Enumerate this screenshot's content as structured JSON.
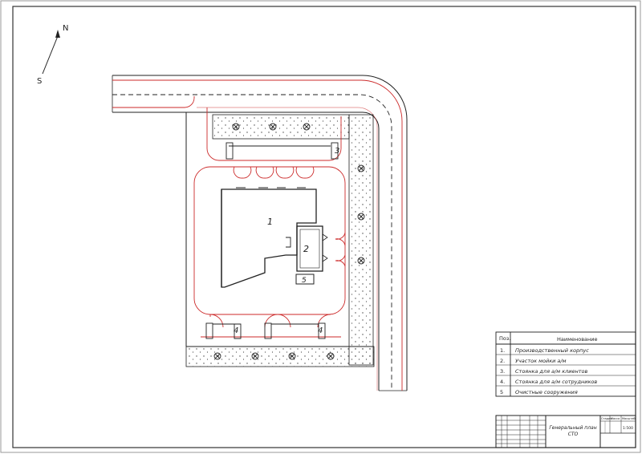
{
  "compass": {
    "north": "N",
    "south": "S"
  },
  "plan_labels": {
    "building": "1",
    "wash": "2",
    "client_parking": "3",
    "staff_parking_a": "4",
    "staff_parking_b": "4",
    "treatment": "5"
  },
  "legend": {
    "pos_header": "Поз.",
    "name_header": "Наименование",
    "rows": [
      {
        "pos": "1.",
        "name": "Производственный корпус"
      },
      {
        "pos": "2.",
        "name": "Участок мойки а/м"
      },
      {
        "pos": "3.",
        "name": "Стоянка для а/м клиентов"
      },
      {
        "pos": "4.",
        "name": "Стоянка для а/м сотрудников"
      },
      {
        "pos": "5",
        "name": "Очистные сооружения"
      }
    ]
  },
  "title_block": {
    "title_line1": "Генеральный план",
    "title_line2": "СТО",
    "stage_header": "Стадия",
    "sheet_header": "Масса",
    "scale_header": "Масштаб",
    "scale_value": "1:500"
  },
  "colors": {
    "line": "#222222",
    "road_edge": "#cc2a2a",
    "frame": "#333333"
  }
}
